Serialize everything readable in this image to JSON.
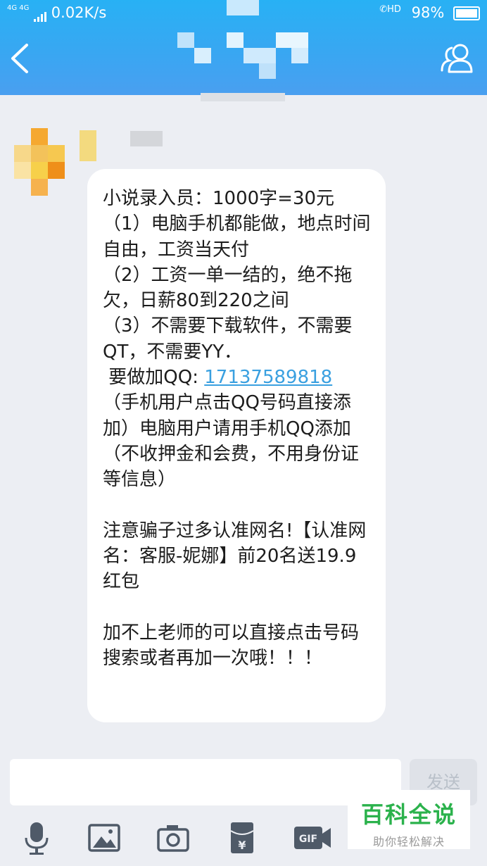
{
  "status_bar": {
    "network": "4G 4G",
    "speed": "0.02K/s",
    "hd": "HD",
    "battery": "98%"
  },
  "header": {
    "back_icon": "chevron-left-icon",
    "contacts_icon": "contacts-icon"
  },
  "message": {
    "line1": "小说录入员：1000字=30元\n（1）电脑手机都能做，地点时间自由，工资当天付\n（2）工资一单一结的，绝不拖欠，日薪80到220之间\n（3）不需要下载软件，不需要QT，不需要YY．\n 要做加QQ: ",
    "qq": "17137589818",
    "line2": "\n（手机用户点击QQ号码直接添加）电脑用户请用手机QQ添加\n（不收押金和会费，不用身份证等信息）\n\n注意骗子过多认准网名!【认准网名：客服-妮娜】前20名送19.9红包\n\n加不上老师的可以直接点击号码搜索或者再加一次哦！！！"
  },
  "composer": {
    "send_label": "发送"
  },
  "toolbar": {
    "icons": [
      "microphone-icon",
      "image-icon",
      "camera-icon",
      "red-packet-icon",
      "gif-icon",
      "emoji-icon"
    ]
  },
  "watermark": {
    "title": "百科全说",
    "subtitle": "助你轻松解决"
  },
  "colors": {
    "header": "#3aa6f2",
    "link": "#3aa0e0",
    "watermark": "#2bb24c"
  }
}
